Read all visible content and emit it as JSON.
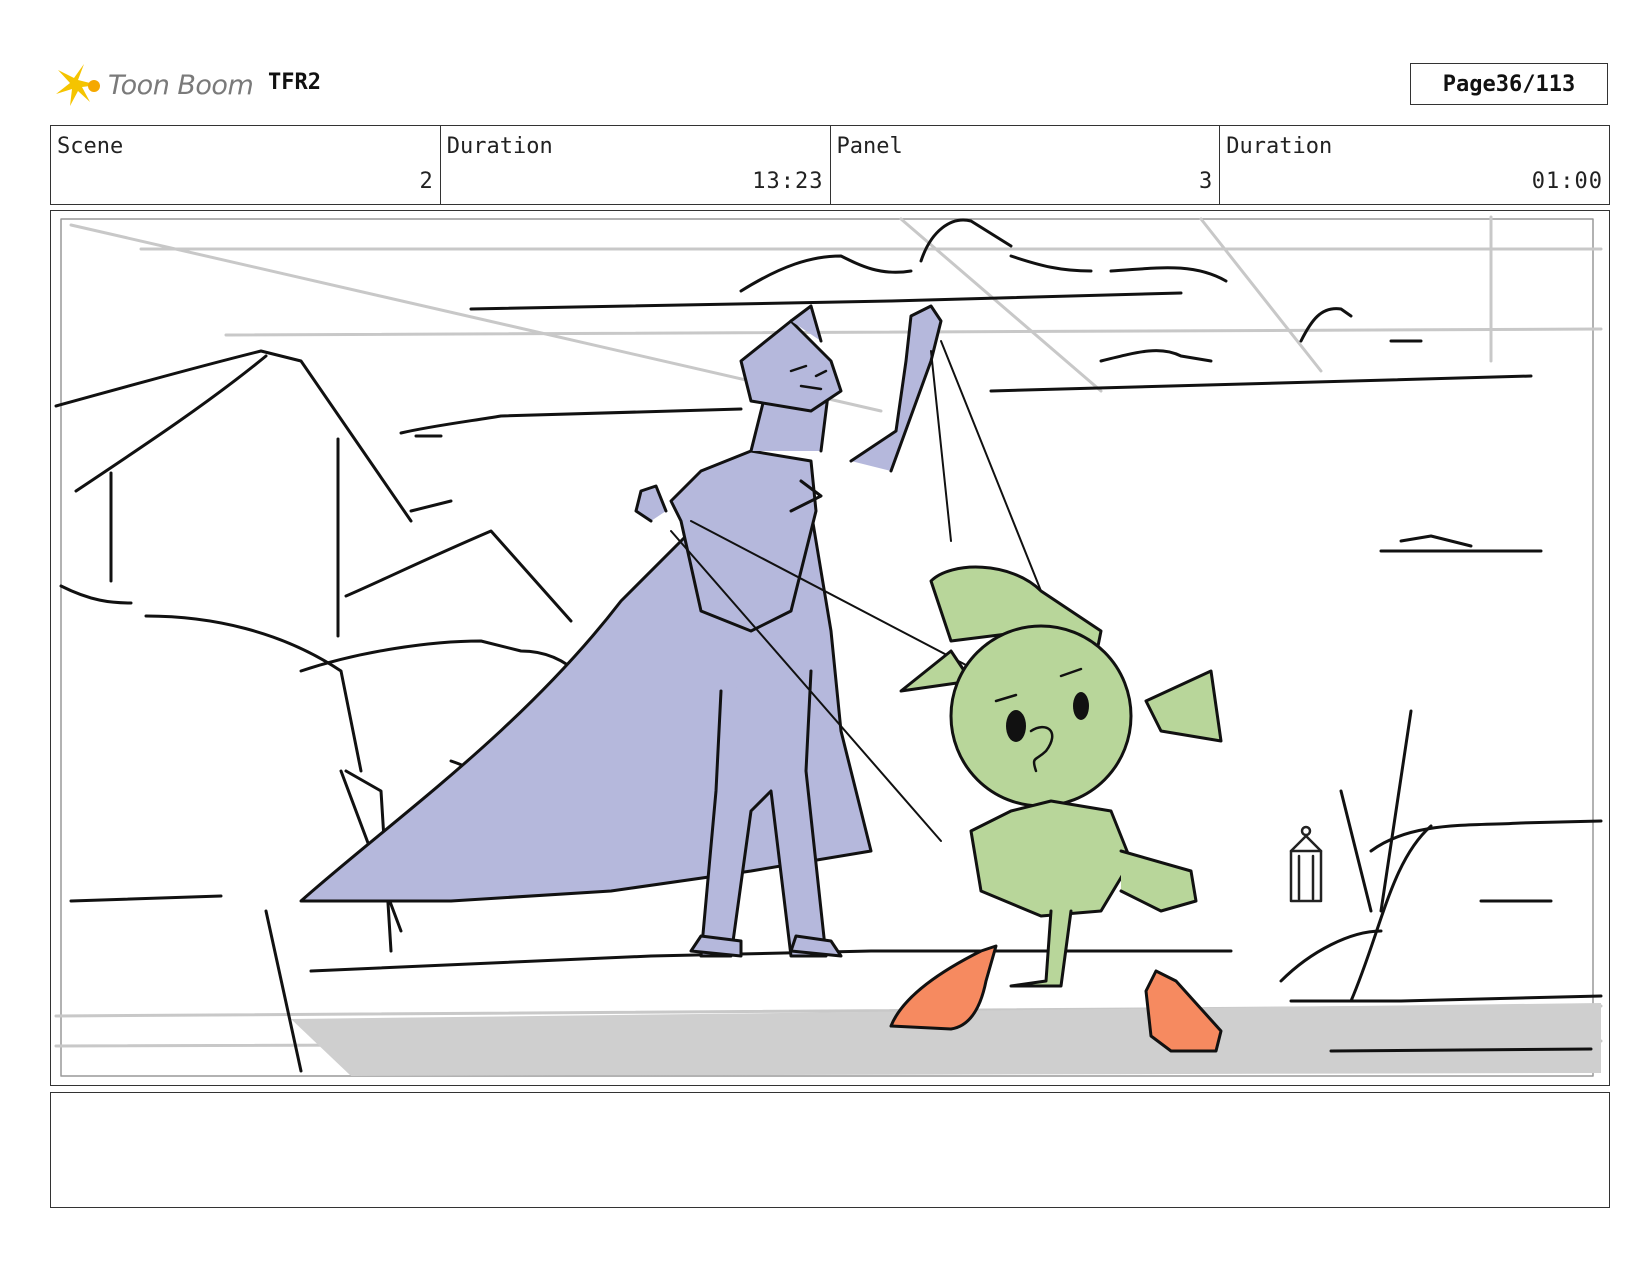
{
  "header": {
    "logo_text": "Toon Boom",
    "project": "TFR2",
    "page_label": "Page",
    "page_value": "36/113"
  },
  "info": {
    "scene_label": "Scene",
    "scene_value": "2",
    "scene_duration_label": "Duration",
    "scene_duration_value": "13:23",
    "panel_label": "Panel",
    "panel_value": "3",
    "panel_duration_label": "Duration",
    "panel_duration_value": "01:00"
  },
  "colors": {
    "villain": "#b5b8dc",
    "sprout": "#b8d69a",
    "shoes": "#f68a60",
    "ground": "#cfcfcf",
    "logo": "#f5c400"
  },
  "notes": ""
}
